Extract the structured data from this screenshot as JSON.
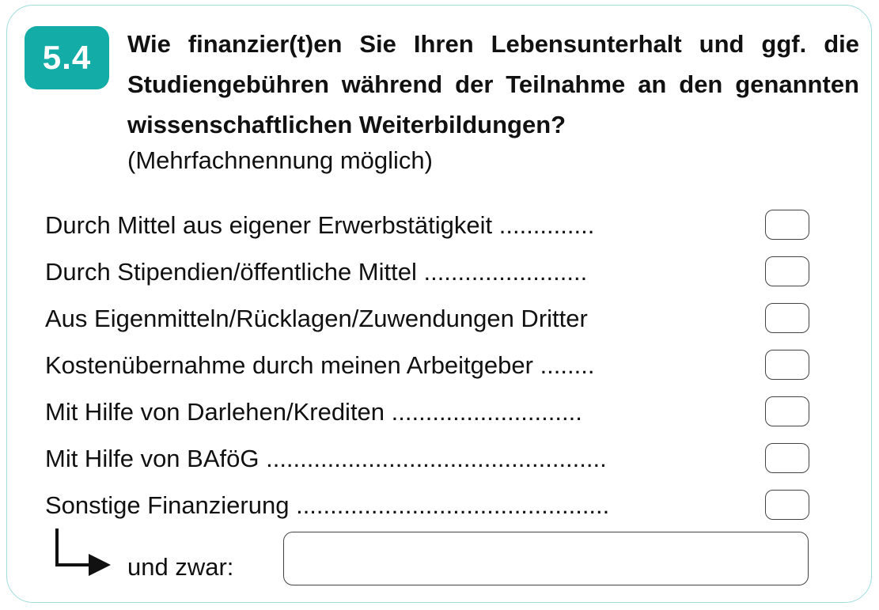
{
  "accent_color": "#14aca6",
  "question": {
    "number": "5.4",
    "text": "Wie finanzier(t)en Sie Ihren Lebensunterhalt und ggf. die Studiengebühren während der Teilnahme an den genannten wissenschaftlichen Weiterbildungen?",
    "note": "(Mehrfachnennung möglich)"
  },
  "options": [
    {
      "label": "Durch Mittel aus eigener Erwerbstätigkeit ..............",
      "checked": false
    },
    {
      "label": "Durch Stipendien/öffentliche Mittel ........................",
      "checked": false
    },
    {
      "label": "Aus Eigenmitteln/Rücklagen/Zuwendungen Dritter",
      "checked": false
    },
    {
      "label": "Kostenübernahme durch meinen Arbeitgeber ........",
      "checked": false
    },
    {
      "label": "Mit Hilfe von Darlehen/Krediten ............................",
      "checked": false
    },
    {
      "label": "Mit Hilfe von BAföG ..................................................",
      "checked": false
    },
    {
      "label": "Sonstige Finanzierung ..............................................",
      "checked": false
    }
  ],
  "other": {
    "label": "und zwar:",
    "value": "",
    "icon": "arrow-right-icon"
  }
}
